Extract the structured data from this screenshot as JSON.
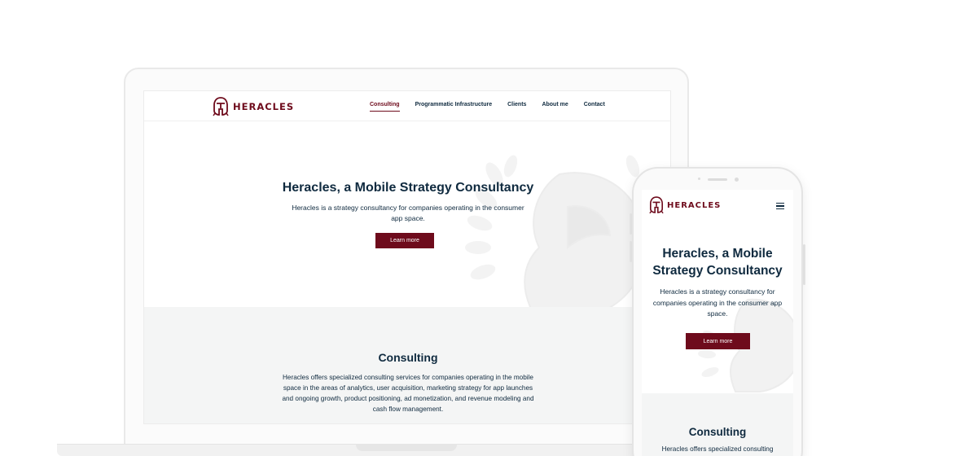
{
  "brand": {
    "name": "HERACLES",
    "accent_color": "#6e0b1c",
    "text_color": "#0f2a3f",
    "section_bg": "#f4f5f5",
    "logo_icon": "helmet-icon"
  },
  "nav": {
    "items": [
      {
        "label": "Consulting",
        "active": true
      },
      {
        "label": "Programmatic Infrastructure",
        "active": false
      },
      {
        "label": "Clients",
        "active": false
      },
      {
        "label": "About me",
        "active": false
      },
      {
        "label": "Contact",
        "active": false
      }
    ],
    "mobile_menu_icon": "hamburger-menu-icon"
  },
  "hero": {
    "title": "Heracles, a Mobile Strategy Consultancy",
    "subtitle": "Heracles is a strategy consultancy for companies operating in the consumer app space.",
    "cta_label": "Learn more",
    "background_icon": "laurel-warrior-illustration"
  },
  "consulting": {
    "title": "Consulting",
    "body": "Heracles offers specialized consulting services for companies operating in the mobile space in the areas of analytics, user acquisition, marketing strategy for app launches and ongoing growth, product positioning, ad monetization, and revenue modeling and cash flow management.",
    "mobile_body_visible": "Heracles offers specialized consulting"
  }
}
